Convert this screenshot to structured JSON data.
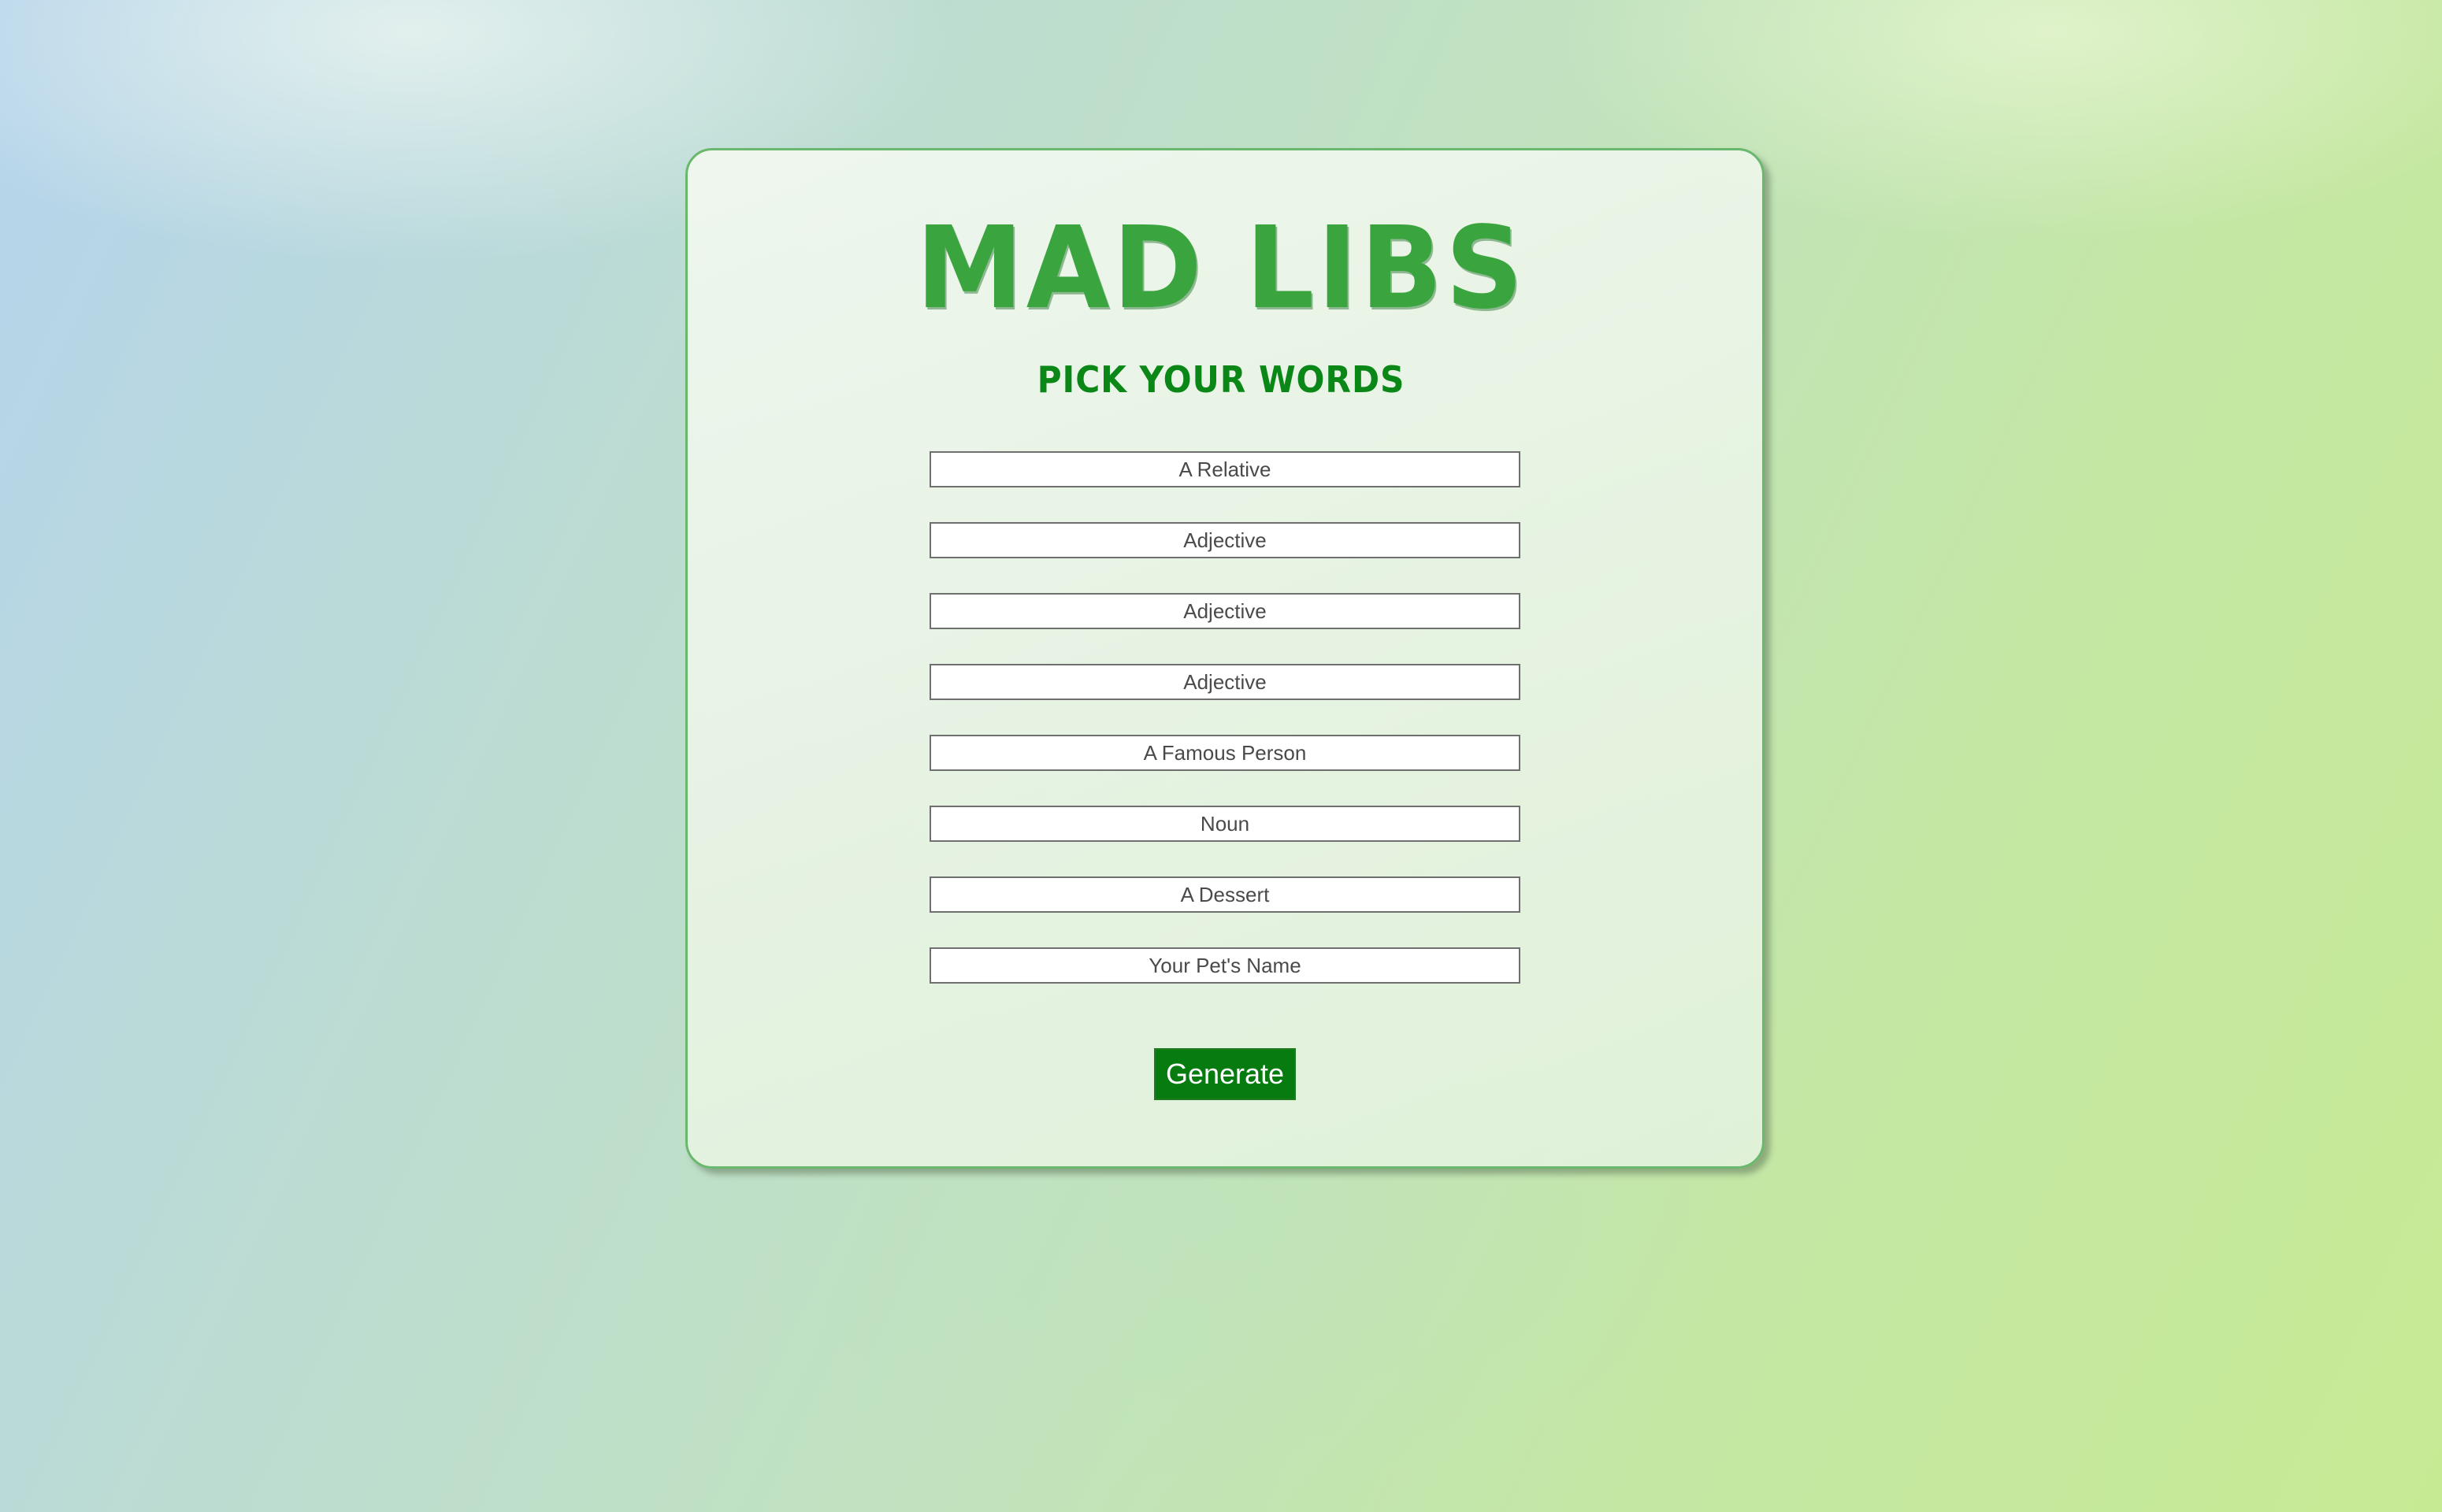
{
  "header": {
    "title": "MAD LIBS",
    "subtitle": "PICK YOUR WORDS"
  },
  "form": {
    "fields": [
      {
        "placeholder": "A Relative",
        "value": ""
      },
      {
        "placeholder": "Adjective",
        "value": ""
      },
      {
        "placeholder": "Adjective",
        "value": ""
      },
      {
        "placeholder": "Adjective",
        "value": ""
      },
      {
        "placeholder": "A Famous Person",
        "value": ""
      },
      {
        "placeholder": "Noun",
        "value": ""
      },
      {
        "placeholder": "A Dessert",
        "value": ""
      },
      {
        "placeholder": "Your Pet's Name",
        "value": ""
      }
    ],
    "submit_label": "Generate"
  },
  "colors": {
    "title": "#3aa53f",
    "subtitle": "#0a8716",
    "button": "#067c10",
    "card_border": "#6ab86e"
  }
}
